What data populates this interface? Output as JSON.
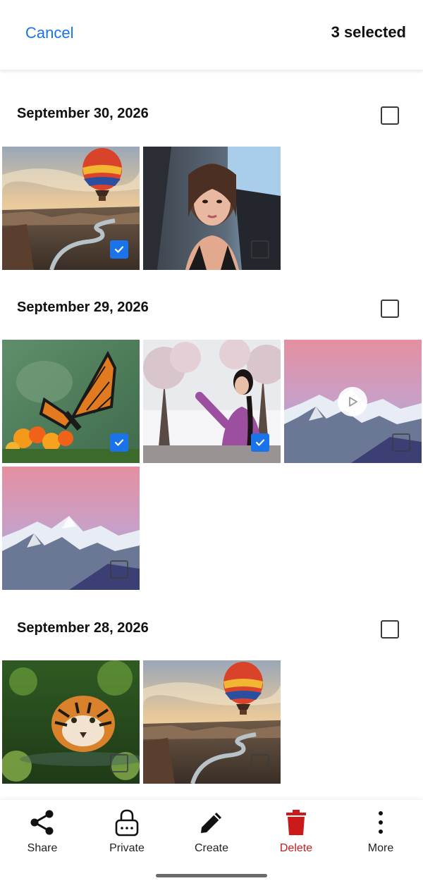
{
  "header": {
    "cancel_label": "Cancel",
    "selection_count": "3 selected"
  },
  "sections": [
    {
      "date": "September 30, 2026",
      "photos": [
        {
          "subject": "hot air balloon over canyon",
          "selected": true
        },
        {
          "subject": "woman selfie in car",
          "selected": false
        }
      ]
    },
    {
      "date": "September 29, 2026",
      "photos": [
        {
          "subject": "monarch butterfly on orange flowers",
          "selected": true
        },
        {
          "subject": "woman in purple sweater with blossoms",
          "selected": true
        },
        {
          "subject": "snowy mountains at dusk",
          "type": "video",
          "selected": false
        },
        {
          "subject": "snowy mountains at dusk",
          "selected": false
        }
      ]
    },
    {
      "date": "September 28, 2026",
      "photos": [
        {
          "subject": "tiger in water",
          "selected": false
        },
        {
          "subject": "hot air balloon over canyon",
          "selected": false
        }
      ]
    }
  ],
  "actions": [
    {
      "label": "Share",
      "icon": "share-icon"
    },
    {
      "label": "Private",
      "icon": "lock-icon"
    },
    {
      "label": "Create",
      "icon": "pencil-icon"
    },
    {
      "label": "Delete",
      "icon": "trash-icon",
      "color": "#cc1a1a"
    },
    {
      "label": "More",
      "icon": "more-vertical-icon"
    }
  ],
  "colors": {
    "accent": "#1a73e8",
    "danger": "#cc1a1a"
  }
}
